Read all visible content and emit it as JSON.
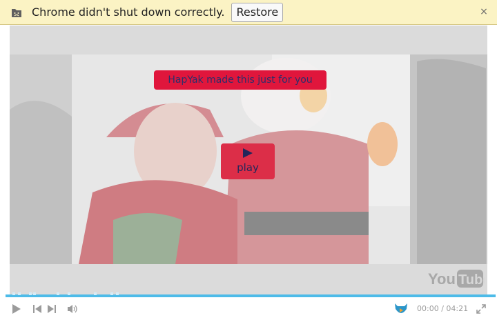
{
  "infobar": {
    "message": "Chrome didn't shut down correctly.",
    "restore_label": "Restore",
    "close_glyph": "×",
    "icon": "sad-folder-icon"
  },
  "video": {
    "banner_text": "HapYak made this just for you",
    "play_label": "play",
    "watermark": "YouTube",
    "colors": {
      "banner": "#e0163c",
      "play": "#dc2e48",
      "progress": "#4dbbe8"
    }
  },
  "controls": {
    "time_current": "00:00",
    "time_separator": "/",
    "time_total": "04:21",
    "icons": [
      "play-icon",
      "previous-icon",
      "next-icon",
      "volume-icon",
      "hapyak-logo-icon",
      "fullscreen-icon"
    ]
  }
}
